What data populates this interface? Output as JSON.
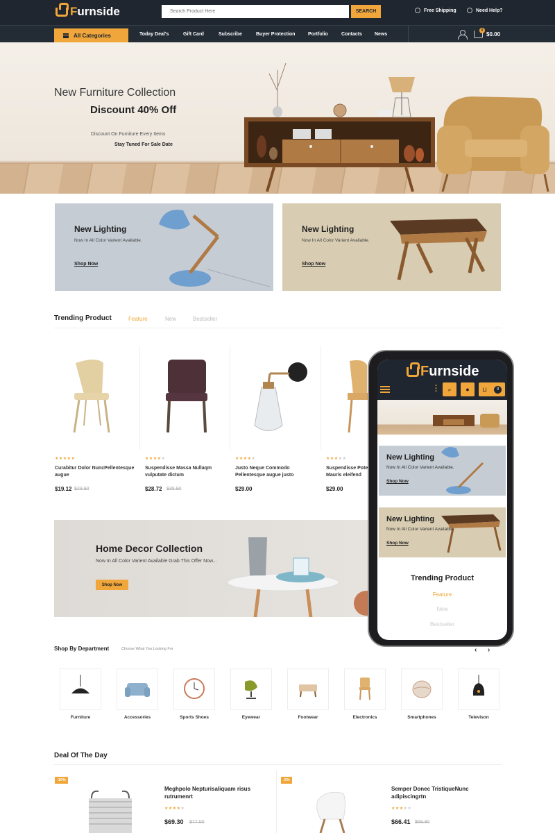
{
  "header": {
    "logo_text": "Furnside",
    "search_placeholder": "Search Product Here",
    "search_button": "SEARCH",
    "free_shipping": "Free Shipping",
    "need_help": "Need Help?"
  },
  "nav": {
    "all_categories": "All Categories",
    "items": [
      "Today Deal's",
      "Gift Card",
      "Subscribe",
      "Buyer Protection",
      "Portfolio",
      "Contacts",
      "News"
    ],
    "cart_count": "0",
    "cart_total": "$0.00"
  },
  "hero": {
    "line1": "New Furniture Collection",
    "line2": "Discount 40% Off",
    "line3": "Discount On Furniture Every Items",
    "line4": "Stay Tuned For Sale Date"
  },
  "banners": [
    {
      "title": "New Lighting",
      "subtitle": "Now In All Color Varient Available.",
      "link": "Shop Now",
      "bg": "#c5ccd4"
    },
    {
      "title": "New Lighting",
      "subtitle": "Now In All Color Varient Available.",
      "link": "Shop Now",
      "bg": "#d8ccb2"
    }
  ],
  "trending": {
    "title": "Trending Product",
    "tabs": [
      "Feature",
      "New",
      "Bestseller"
    ],
    "products": [
      {
        "name_line1": "Curabitur Dolor NuncPellentesque",
        "name_line2": "augue",
        "price": "$19.12",
        "old_price": "$23.90",
        "rating": 5
      },
      {
        "name_line1": "Suspendisse Massa Nullaqm",
        "name_line2": "vulputate dictum",
        "price": "$28.72",
        "old_price": "$35.90",
        "rating": 4
      },
      {
        "name_line1": "Justo Neque Commodo",
        "name_line2": "Pellentesque augue justo",
        "price": "$29.00",
        "old_price": "",
        "rating": 4
      },
      {
        "name_line1": "Suspendisse Pote",
        "name_line2": "Mauris eleifend",
        "price": "$29.00",
        "old_price": "",
        "rating": 3
      }
    ]
  },
  "decor": {
    "title": "Home Decor Collection",
    "subtitle": "Now In All Color Varient Available Grab This Offer Now...",
    "button": "Shop Now"
  },
  "phone": {
    "logo_text": "Furnside",
    "cart_count": "0",
    "banners": [
      {
        "title": "New Lighting",
        "subtitle": "Now In All Color Varient Available.",
        "link": "Shop Now"
      },
      {
        "title": "New Lighting",
        "subtitle": "Now In All Color Varient Available.",
        "link": "Shop Now"
      }
    ],
    "trend_title": "Trending Product",
    "tabs": [
      "Feature",
      "New",
      "Bestseller"
    ]
  },
  "department": {
    "title": "Shop By Department",
    "subtitle": "Choose What You Looking For",
    "items": [
      "Furniture",
      "Accessories",
      "Sports Shoes",
      "Eyewear",
      "Footwear",
      "Electronics",
      "Smartphones",
      "Televison"
    ]
  },
  "deals": {
    "title": "Deal Of The Day",
    "items": [
      {
        "badge": "-10%",
        "name_line1": "Meghpolo Nepturisaliquam risus",
        "name_line2": "rutrumenrt",
        "price": "$69.30",
        "old_price": "$77.00",
        "rating": 4
      },
      {
        "badge": "-5%",
        "name_line1": "Semper Donec TristiqueNunc",
        "name_line2": "adipiscingrtn",
        "price": "$66.41",
        "old_price": "$69.90",
        "rating": 3
      }
    ]
  },
  "colors": {
    "accent": "#f0a63a",
    "dark": "#1f2630"
  }
}
